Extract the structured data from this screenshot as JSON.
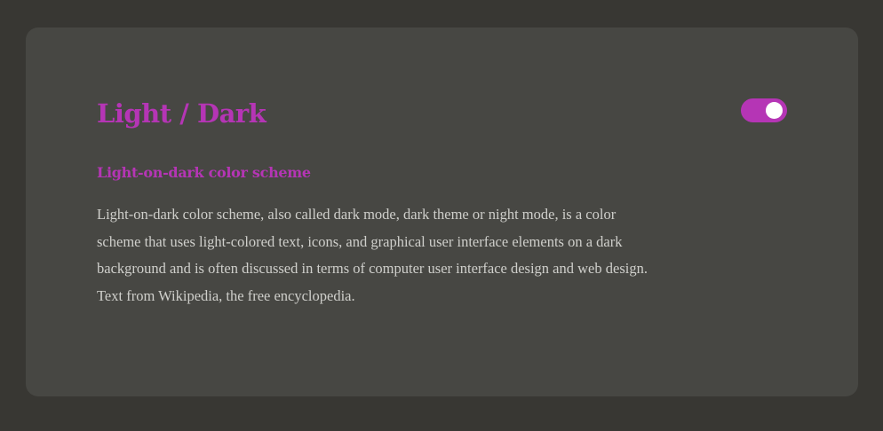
{
  "card": {
    "title": "Light / Dark",
    "toggle": {
      "state": "on",
      "color": "#b535b5"
    },
    "subtitle": "Light-on-dark color scheme",
    "body": "Light-on-dark color scheme, also called dark mode, dark theme or night mode, is a color scheme that uses light-colored text, icons, and graphical user interface elements on a dark background and is often discussed in terms of computer user interface design and web design. Text from Wikipedia, the free encyclopedia."
  },
  "colors": {
    "page_background": "#383733",
    "card_background": "#474743",
    "accent": "#b535b5",
    "text": "#cfcfcb"
  }
}
